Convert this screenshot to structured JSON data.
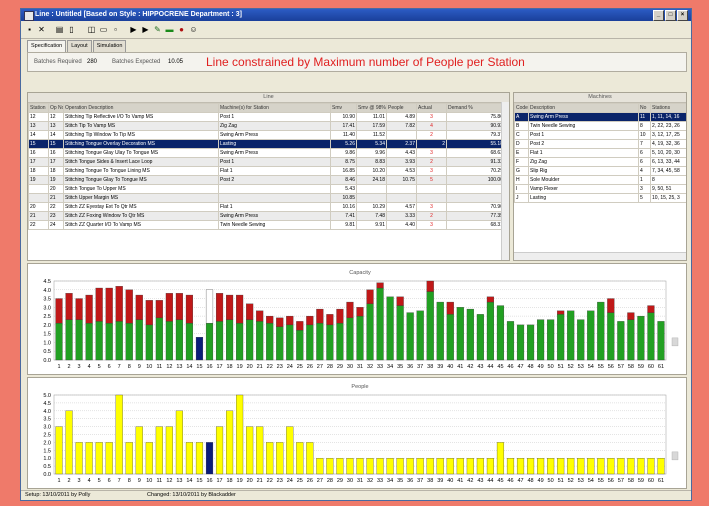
{
  "window": {
    "title": "Line : Untitled      [Based on Style : HIPPOCRENE   Department : 3]"
  },
  "tabs": [
    "Specification",
    "Layout",
    "Simulation"
  ],
  "info": {
    "batches_required_label": "Batches Required",
    "batches_required": "280",
    "batches_expected_label": "Batches Expected",
    "batches_expected": "10.05",
    "headline": "Line constrained by Maximum number of People per Station"
  },
  "line": {
    "title": "Line",
    "columns": [
      "Station",
      "Op No",
      "Operation Description",
      "Machine(s) for Station",
      "Smv",
      "Smv @ 98%",
      "People",
      "Actual",
      "Demand %"
    ],
    "rows": [
      [
        "12",
        "12",
        "Stitching Tip Reflective I/O To Vamp MS",
        "Post 1",
        "10.90",
        "11.01",
        "4.89",
        "3",
        "75.86"
      ],
      [
        "13",
        "13",
        "Stitch Tip To Vamp MS",
        "Zig Zag",
        "17.41",
        "17.59",
        "7.82",
        "4",
        "90.93"
      ],
      [
        "14",
        "14",
        "Stitching Tip Window To Tip MS",
        "Swing Arm Press",
        "11.40",
        "11.52",
        "",
        "2",
        "79.37"
      ],
      [
        "15",
        "15",
        "Stitching Tongue Overlay Decoration MS",
        "Lasting",
        "5.26",
        "5.34",
        "2.37",
        "2",
        "55.18"
      ],
      [
        "16",
        "16",
        "Stitching Tongue Glay Ulay To Tongue MS",
        "Swing Arm Press",
        "9.86",
        "9.96",
        "4.43",
        "3",
        "68.63"
      ],
      [
        "17",
        "17",
        "Stitch Tongue Sides & Insert Lace Loop",
        "Post 1",
        "8.75",
        "8.83",
        "3.93",
        "2",
        "91.32"
      ],
      [
        "18",
        "18",
        "Stitching Tongue To Tongue Lining MS",
        "Flat 1",
        "16.85",
        "10.20",
        "4.53",
        "3",
        "70.29"
      ],
      [
        "19",
        "19",
        "Stitching Tongue Glay To Tongue MS",
        "Post 2",
        "8.46",
        "24.18",
        "10.75",
        "5",
        "100.00"
      ],
      [
        "",
        "20",
        "Stitch Tongue To Upper MS",
        "",
        "5.43",
        "",
        "",
        "",
        ""
      ],
      [
        "",
        "21",
        "Stitch Upper Margin MS",
        "",
        "10.85",
        "",
        "",
        "",
        ""
      ],
      [
        "20",
        "22",
        "Stitch ZZ Eyestay Ext To Qtr MS",
        "Flat 1",
        "10.16",
        "10.29",
        "4.57",
        "3",
        "70.90"
      ],
      [
        "21",
        "23",
        "Stitch ZZ Foxing Window To Qtr MS",
        "Swing Arm Press",
        "7.41",
        "7.48",
        "3.33",
        "2",
        "77.35"
      ],
      [
        "22",
        "24",
        "Stitch ZZ Quarter I/O To Vamp MS",
        "Twin Needle Sewing",
        "9.81",
        "9.91",
        "4.40",
        "3",
        "68.31"
      ]
    ]
  },
  "machines": {
    "title": "Machines",
    "columns": [
      "Code",
      "Description",
      "No",
      "Stations"
    ],
    "rows": [
      [
        "A",
        "Swing Arm Press",
        "11",
        "1, 11, 14, 16"
      ],
      [
        "B",
        "Twin Needle Sewing",
        "8",
        "2, 22, 23, 26"
      ],
      [
        "C",
        "Post 1",
        "10",
        "3, 12, 17, 25"
      ],
      [
        "D",
        "Post 2",
        "7",
        "4, 19, 32, 36"
      ],
      [
        "E",
        "Flat 1",
        "6",
        "5, 10, 20, 30"
      ],
      [
        "F",
        "Zig Zag",
        "6",
        "6, 13, 33, 44"
      ],
      [
        "G",
        "Slip Rig",
        "4",
        "7, 34, 45, 58"
      ],
      [
        "H",
        "Sole Moulder",
        "1",
        "8"
      ],
      [
        "I",
        "Vamp Flexer",
        "3",
        "9, 50, 51"
      ],
      [
        "J",
        "Lasting",
        "5",
        "10, 15, 25, 3"
      ]
    ]
  },
  "status": {
    "setup": "Setup: 13/10/2011 by Polly",
    "changed": "Changed: 13/10/2011 by Blackadder"
  },
  "chart_data": [
    {
      "type": "bar",
      "title": "Capacity",
      "ylim": [
        0,
        4.5
      ],
      "yticks": [
        "0.0",
        "0.5",
        "1.0",
        "1.5",
        "2.0",
        "2.5",
        "3.0",
        "3.5",
        "4.0",
        "4.5"
      ],
      "categories": [
        "1",
        "2",
        "3",
        "4",
        "5",
        "6",
        "7",
        "8",
        "9",
        "10",
        "11",
        "12",
        "13",
        "14",
        "15",
        "16",
        "17",
        "18",
        "19",
        "20",
        "21",
        "22",
        "23",
        "24",
        "25",
        "26",
        "27",
        "28",
        "29",
        "30",
        "31",
        "32",
        "33",
        "34",
        "35",
        "36",
        "37",
        "38",
        "39",
        "40",
        "41",
        "42",
        "43",
        "44",
        "45",
        "46",
        "47",
        "48",
        "49",
        "50",
        "51",
        "52",
        "53",
        "54",
        "55",
        "56",
        "57",
        "58",
        "59",
        "60",
        "61"
      ],
      "series": [
        {
          "color": "#22a022",
          "values": [
            2.1,
            2.3,
            2.3,
            2.1,
            2.2,
            2.1,
            2.2,
            2.1,
            2.3,
            2.0,
            2.4,
            2.2,
            2.3,
            2.1,
            1.3,
            2.1,
            2.2,
            2.3,
            2.1,
            2.3,
            2.2,
            2.1,
            1.9,
            2.0,
            1.7,
            2.0,
            2.1,
            2.0,
            2.1,
            2.4,
            2.5,
            3.2,
            4.1,
            3.6,
            3.1,
            2.7,
            2.8,
            3.9,
            3.3,
            2.6,
            3.0,
            2.9,
            2.6,
            3.3,
            3.1,
            2.2,
            2.0,
            2.0,
            2.3,
            2.3,
            2.6,
            2.8,
            2.3,
            2.8,
            3.3,
            2.7,
            2.2,
            2.3,
            2.5,
            2.7,
            2.2
          ]
        },
        {
          "color": "#c01818",
          "values": [
            1.4,
            1.5,
            1.2,
            1.6,
            1.9,
            2.0,
            2.0,
            1.9,
            1.4,
            1.4,
            1.0,
            1.6,
            1.5,
            1.6,
            0,
            0,
            1.6,
            1.4,
            1.6,
            0.9,
            0.6,
            0.4,
            0.5,
            0.5,
            0.5,
            0.5,
            0.8,
            0.6,
            0.8,
            0.9,
            0.5,
            0.8,
            0.3,
            0,
            0.5,
            0,
            0,
            0.6,
            0,
            0.7,
            0,
            0,
            0,
            0.3,
            0,
            0,
            0,
            0,
            0,
            0,
            0.2,
            0,
            0,
            0,
            0,
            0.8,
            0,
            0.4,
            0,
            0.4,
            0
          ]
        },
        {
          "color": "#ffffff",
          "values": [
            0,
            0,
            0,
            0,
            0,
            0,
            0,
            0,
            0,
            0,
            0,
            0,
            0,
            0,
            0,
            1.9,
            0,
            0,
            0,
            0,
            0,
            0,
            0,
            0,
            0,
            0,
            0,
            0,
            0,
            0,
            0,
            0,
            0,
            0,
            0,
            0,
            0,
            0,
            0,
            0,
            0,
            0,
            0,
            0,
            0,
            0,
            0,
            0,
            0,
            0,
            0,
            0,
            0,
            0,
            0,
            0,
            0,
            0,
            0,
            0,
            0
          ]
        },
        {
          "color": "#0a1c7a",
          "values": [
            0,
            0,
            0,
            0,
            0,
            0,
            0,
            0,
            0,
            0,
            0,
            0,
            0,
            0,
            0,
            0,
            0,
            0,
            0,
            0,
            0,
            0,
            0,
            0,
            0,
            0,
            0,
            0,
            0,
            0,
            0,
            0,
            0,
            0,
            0,
            0,
            0,
            0,
            0,
            0,
            0,
            0,
            0,
            0,
            0,
            0,
            0,
            0,
            0,
            0,
            0,
            0,
            0,
            0,
            0,
            0,
            0,
            0,
            0,
            0,
            0
          ]
        }
      ],
      "highlight_index": 14,
      "highlight_color": "#0a1c7a"
    },
    {
      "type": "bar",
      "title": "People",
      "ylim": [
        0,
        5.0
      ],
      "yticks": [
        "0.0",
        "0.5",
        "1.0",
        "1.5",
        "2.0",
        "2.5",
        "3.0",
        "3.5",
        "4.0",
        "4.5",
        "5.0"
      ],
      "categories": [
        "1",
        "2",
        "3",
        "4",
        "5",
        "6",
        "7",
        "8",
        "9",
        "10",
        "11",
        "12",
        "13",
        "14",
        "15",
        "16",
        "17",
        "18",
        "19",
        "20",
        "21",
        "22",
        "23",
        "24",
        "25",
        "26",
        "27",
        "28",
        "29",
        "30",
        "31",
        "32",
        "33",
        "34",
        "35",
        "36",
        "37",
        "38",
        "39",
        "40",
        "41",
        "42",
        "43",
        "44",
        "45",
        "46",
        "47",
        "48",
        "49",
        "50",
        "51",
        "52",
        "53",
        "54",
        "55",
        "56",
        "57",
        "58",
        "59",
        "60",
        "61"
      ],
      "values": [
        3,
        4,
        2,
        2,
        2,
        2,
        5,
        2,
        3,
        2,
        3,
        3,
        4,
        2,
        2,
        2,
        3,
        4,
        5,
        3,
        3,
        2,
        2,
        3,
        2,
        2,
        1,
        1,
        1,
        1,
        1,
        1,
        1,
        1,
        1,
        1,
        1,
        1,
        1,
        1,
        1,
        1,
        1,
        1,
        2,
        1,
        1,
        1,
        1,
        1,
        1,
        1,
        1,
        1,
        1,
        1,
        1,
        1,
        1,
        1,
        1
      ],
      "color": "#ffff00",
      "highlight_index": 15,
      "highlight_color": "#0a1c7a"
    }
  ]
}
